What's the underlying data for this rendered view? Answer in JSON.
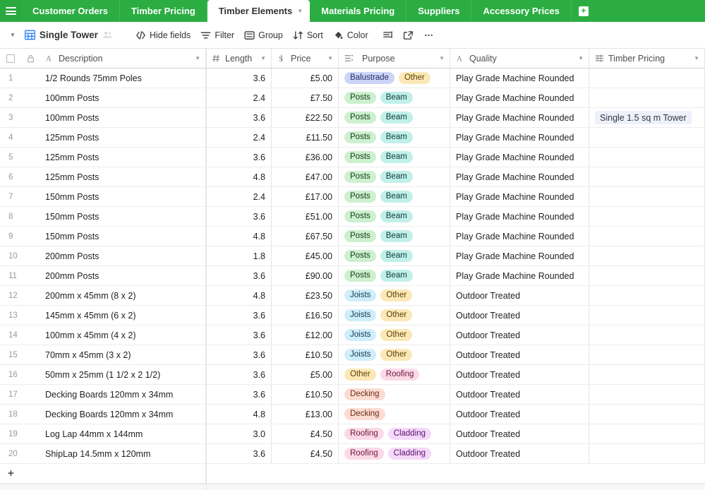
{
  "colors": {
    "tabbar_green": "#2bad42",
    "hamburger_green": "#29a93f",
    "grid_icon_blue": "#2d7ff9",
    "chip_link_bg": "#eef1fb"
  },
  "tabbar": {
    "menu_icon": "hamburger-icon",
    "add_tab_label": "+",
    "tabs": [
      {
        "label": "Customer Orders",
        "active": false
      },
      {
        "label": "Timber Pricing",
        "active": false
      },
      {
        "label": "Timber Elements",
        "active": true
      },
      {
        "label": "Materials Pricing",
        "active": false
      },
      {
        "label": "Suppliers",
        "active": false
      },
      {
        "label": "Accessory Prices",
        "active": false
      }
    ]
  },
  "toolbar": {
    "view_caret": "chevron-down-icon",
    "view_icon": "grid-view-icon",
    "view_name": "Single Tower",
    "collaborators_icon": "collaborators-icon",
    "buttons": [
      {
        "label": "Hide fields",
        "icon": "hide-fields-icon"
      },
      {
        "label": "Filter",
        "icon": "filter-icon"
      },
      {
        "label": "Group",
        "icon": "group-icon"
      },
      {
        "label": "Sort",
        "icon": "sort-icon"
      },
      {
        "label": "Color",
        "icon": "color-icon"
      }
    ],
    "icon_buttons": [
      {
        "name": "row-height-icon"
      },
      {
        "name": "share-view-icon"
      },
      {
        "name": "more-options-icon"
      }
    ]
  },
  "grid": {
    "select_all_checkbox": "select-all-checkbox",
    "lock_icon": "lock-icon",
    "add_row_label": "+",
    "columns": [
      {
        "label": "Description",
        "icon": "text-field-icon",
        "type": "text"
      },
      {
        "label": "Length",
        "icon": "number-field-icon",
        "type": "number"
      },
      {
        "label": "Price",
        "icon": "currency-field-icon",
        "type": "currency"
      },
      {
        "label": "Purpose",
        "icon": "multiselect-field-icon",
        "type": "multiselect"
      },
      {
        "label": "Quality",
        "icon": "text-field-icon",
        "type": "text"
      },
      {
        "label": "Timber Pricing",
        "icon": "linked-record-field-icon",
        "type": "link"
      }
    ],
    "tag_styles": {
      "Balustrade": {
        "bg": "#ccd4f7",
        "fg": "#1f2d5c"
      },
      "Other": {
        "bg": "#fce8b6",
        "fg": "#5c4205"
      },
      "Posts": {
        "bg": "#cdf0ce",
        "fg": "#133b18"
      },
      "Beam": {
        "bg": "#c1f0ea",
        "fg": "#0d3b36"
      },
      "Joists": {
        "bg": "#cfeefb",
        "fg": "#123a4d"
      },
      "Decking": {
        "bg": "#fcdcd2",
        "fg": "#6b2c16"
      },
      "Roofing": {
        "bg": "#fcd9e6",
        "fg": "#6b1638"
      },
      "Cladding": {
        "bg": "#f5d8fa",
        "fg": "#56156b"
      }
    },
    "rows": [
      {
        "n": "1",
        "description": "1/2 Rounds 75mm Poles",
        "length": "3.6",
        "price": "£5.00",
        "purpose": [
          "Balustrade",
          "Other"
        ],
        "quality": "Play Grade Machine Rounded",
        "pricing": ""
      },
      {
        "n": "2",
        "description": "100mm Posts",
        "length": "2.4",
        "price": "£7.50",
        "purpose": [
          "Posts",
          "Beam"
        ],
        "quality": "Play Grade Machine Rounded",
        "pricing": ""
      },
      {
        "n": "3",
        "description": "100mm Posts",
        "length": "3.6",
        "price": "£22.50",
        "purpose": [
          "Posts",
          "Beam"
        ],
        "quality": "Play Grade Machine Rounded",
        "pricing": "Single 1.5 sq m Tower"
      },
      {
        "n": "4",
        "description": "125mm Posts",
        "length": "2.4",
        "price": "£11.50",
        "purpose": [
          "Posts",
          "Beam"
        ],
        "quality": "Play Grade Machine Rounded",
        "pricing": ""
      },
      {
        "n": "5",
        "description": "125mm Posts",
        "length": "3.6",
        "price": "£36.00",
        "purpose": [
          "Posts",
          "Beam"
        ],
        "quality": "Play Grade Machine Rounded",
        "pricing": ""
      },
      {
        "n": "6",
        "description": "125mm Posts",
        "length": "4.8",
        "price": "£47.00",
        "purpose": [
          "Posts",
          "Beam"
        ],
        "quality": "Play Grade Machine Rounded",
        "pricing": ""
      },
      {
        "n": "7",
        "description": "150mm Posts",
        "length": "2.4",
        "price": "£17.00",
        "purpose": [
          "Posts",
          "Beam"
        ],
        "quality": "Play Grade Machine Rounded",
        "pricing": ""
      },
      {
        "n": "8",
        "description": "150mm Posts",
        "length": "3.6",
        "price": "£51.00",
        "purpose": [
          "Posts",
          "Beam"
        ],
        "quality": "Play Grade Machine Rounded",
        "pricing": ""
      },
      {
        "n": "9",
        "description": "150mm Posts",
        "length": "4.8",
        "price": "£67.50",
        "purpose": [
          "Posts",
          "Beam"
        ],
        "quality": "Play Grade Machine Rounded",
        "pricing": ""
      },
      {
        "n": "10",
        "description": "200mm Posts",
        "length": "1.8",
        "price": "£45.00",
        "purpose": [
          "Posts",
          "Beam"
        ],
        "quality": "Play Grade Machine Rounded",
        "pricing": ""
      },
      {
        "n": "11",
        "description": "200mm Posts",
        "length": "3.6",
        "price": "£90.00",
        "purpose": [
          "Posts",
          "Beam"
        ],
        "quality": "Play Grade Machine Rounded",
        "pricing": ""
      },
      {
        "n": "12",
        "description": "200mm x 45mm (8 x 2)",
        "length": "4.8",
        "price": "£23.50",
        "purpose": [
          "Joists",
          "Other"
        ],
        "quality": "Outdoor Treated",
        "pricing": ""
      },
      {
        "n": "13",
        "description": "145mm x 45mm (6 x 2)",
        "length": "3.6",
        "price": "£16.50",
        "purpose": [
          "Joists",
          "Other"
        ],
        "quality": "Outdoor Treated",
        "pricing": ""
      },
      {
        "n": "14",
        "description": "100mm x 45mm (4 x 2)",
        "length": "3.6",
        "price": "£12.00",
        "purpose": [
          "Joists",
          "Other"
        ],
        "quality": "Outdoor Treated",
        "pricing": ""
      },
      {
        "n": "15",
        "description": "70mm x 45mm (3 x 2)",
        "length": "3.6",
        "price": "£10.50",
        "purpose": [
          "Joists",
          "Other"
        ],
        "quality": "Outdoor Treated",
        "pricing": ""
      },
      {
        "n": "16",
        "description": "50mm x 25mm (1 1/2 x 2 1/2)",
        "length": "3.6",
        "price": "£5.00",
        "purpose": [
          "Other",
          "Roofing"
        ],
        "quality": "Outdoor Treated",
        "pricing": ""
      },
      {
        "n": "17",
        "description": "Decking Boards 120mm x 34mm",
        "length": "3.6",
        "price": "£10.50",
        "purpose": [
          "Decking"
        ],
        "quality": "Outdoor Treated",
        "pricing": ""
      },
      {
        "n": "18",
        "description": "Decking Boards 120mm x 34mm",
        "length": "4.8",
        "price": "£13.00",
        "purpose": [
          "Decking"
        ],
        "quality": "Outdoor Treated",
        "pricing": ""
      },
      {
        "n": "19",
        "description": "Log Lap 44mm x 144mm",
        "length": "3.0",
        "price": "£4.50",
        "purpose": [
          "Roofing",
          "Cladding"
        ],
        "quality": "Outdoor Treated",
        "pricing": ""
      },
      {
        "n": "20",
        "description": "ShipLap 14.5mm x 120mm",
        "length": "3.6",
        "price": "£4.50",
        "purpose": [
          "Roofing",
          "Cladding"
        ],
        "quality": "Outdoor Treated",
        "pricing": ""
      }
    ]
  }
}
